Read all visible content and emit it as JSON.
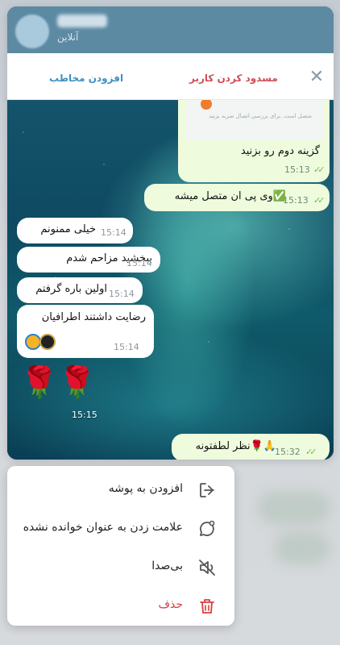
{
  "header": {
    "status": "آنلاین"
  },
  "actions": {
    "add_contact": "افزودن مخاطب",
    "block_user": "مسدود کردن کاربر",
    "close_icon": "close-icon"
  },
  "messages": [
    {
      "text": "گزینه دوم رو بزنید",
      "time": "15:13",
      "direction": "out",
      "read": true
    },
    {
      "text": "وی پی ان متصل میشه✅",
      "time": "15:13",
      "direction": "out",
      "read": true
    },
    {
      "text": "خیلی ممنونم",
      "time": "15:14",
      "direction": "in"
    },
    {
      "text": "ببخشید مزاحم شدم",
      "time": "15:14",
      "direction": "in"
    },
    {
      "text": "اولین باره گرفتم",
      "time": "15:14",
      "direction": "in"
    },
    {
      "text": "رضایت داشتند اطرافیان",
      "time": "15:14",
      "direction": "in"
    },
    {
      "text": "🌹🌹",
      "time": "15:15",
      "direction": "in"
    },
    {
      "text": "نظر لطفتونه🌹🙏",
      "time": "15:32",
      "direction": "out",
      "read": true
    }
  ],
  "screenshot_caption": "متصل است. برای بررسی اتصال ضربه بزنید",
  "menu": [
    {
      "label": "افزودن به پوشه",
      "icon": "folder-add-icon"
    },
    {
      "label": "علامت زدن به عنوان خوانده نشده",
      "icon": "mark-unread-icon"
    },
    {
      "label": "بی‌صدا",
      "icon": "mute-icon"
    },
    {
      "label": "حذف",
      "icon": "trash-icon",
      "danger": true
    }
  ],
  "colors": {
    "header_bg": "#5d8aa3",
    "add_contact": "#3f8fc3",
    "block_user": "#d04e54",
    "outgoing_bubble": "#eefbdd",
    "incoming_bubble": "#ffffff",
    "danger": "#d63f3f",
    "read_tick": "#6fbf4a"
  }
}
